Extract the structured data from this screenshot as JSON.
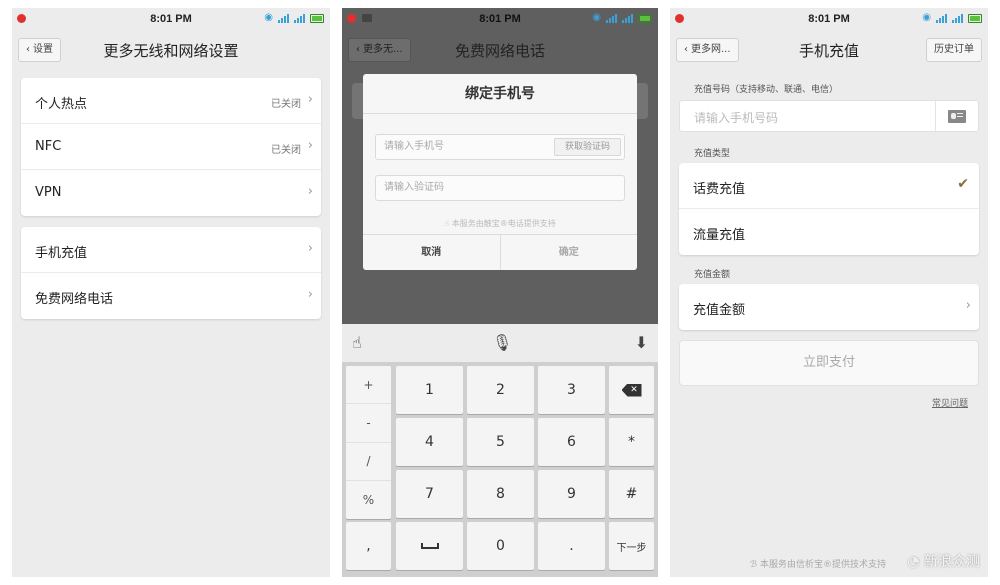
{
  "status": {
    "time": "8:01 PM"
  },
  "screen1": {
    "back": "设置",
    "title": "更多无线和网络设置",
    "group1": [
      {
        "label": "个人热点",
        "value": "已关闭"
      },
      {
        "label": "NFC",
        "value": "已关闭"
      },
      {
        "label": "VPN",
        "value": ""
      }
    ],
    "group2": [
      {
        "label": "手机充值",
        "value": ""
      },
      {
        "label": "免费网络电话",
        "value": ""
      }
    ]
  },
  "screen2": {
    "back": "更多无...",
    "title": "免费网络电话",
    "dialog": {
      "title": "绑定手机号",
      "phone_placeholder": "请输入手机号",
      "get_code": "获取验证码",
      "code_placeholder": "请输入验证码",
      "note": "本服务由触宝®电话提供支持",
      "cancel": "取消",
      "confirm": "确定"
    },
    "keyboard": {
      "symbols": [
        "+",
        "-",
        "/",
        "%",
        ","
      ],
      "digits": [
        "1",
        "2",
        "3",
        "4",
        "5",
        "6",
        "7",
        "8",
        "9",
        "0"
      ],
      "star": "*",
      "hash": "#",
      "dot": ".",
      "next": "下一步"
    }
  },
  "screen3": {
    "back": "更多网...",
    "title": "手机充值",
    "action": "历史订单",
    "phone_label": "充值号码（支持移动、联通、电信）",
    "phone_placeholder": "请输入手机号码",
    "type_label": "充值类型",
    "types": [
      {
        "label": "话费充值"
      },
      {
        "label": "流量充值"
      }
    ],
    "amount_label": "充值金额",
    "amount_row": "充值金额",
    "pay": "立即支付",
    "faq": "常见问题",
    "bottom_note": "本服务由信析宝®提供技术支持",
    "watermark": "新浪众测"
  }
}
